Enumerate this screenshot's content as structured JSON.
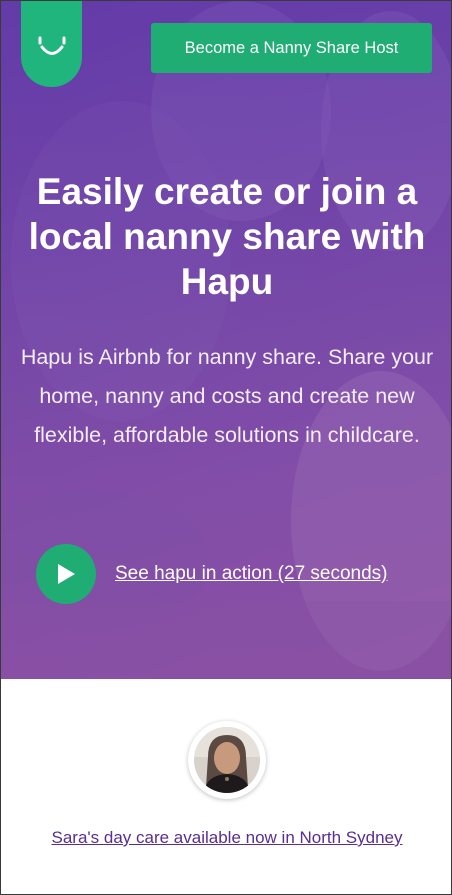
{
  "header": {
    "logo_icon": "smile-logo-icon",
    "host_button_label": "Become a Nanny Share Host"
  },
  "hero": {
    "headline": "Easily create or join a local nanny share with Hapu",
    "subtext": "Hapu is Airbnb for nanny share. Share your home, nanny and costs and create new flexible, affordable solutions in childcare.",
    "video_link": "See hapu in action (27 seconds)",
    "play_icon": "play-icon"
  },
  "featured": {
    "availability_link": "Sara's day care available now in North Sydney"
  },
  "colors": {
    "brand_green": "#1fad73",
    "hero_purple": "#6a3fa6",
    "link_purple": "#5a2d91"
  }
}
